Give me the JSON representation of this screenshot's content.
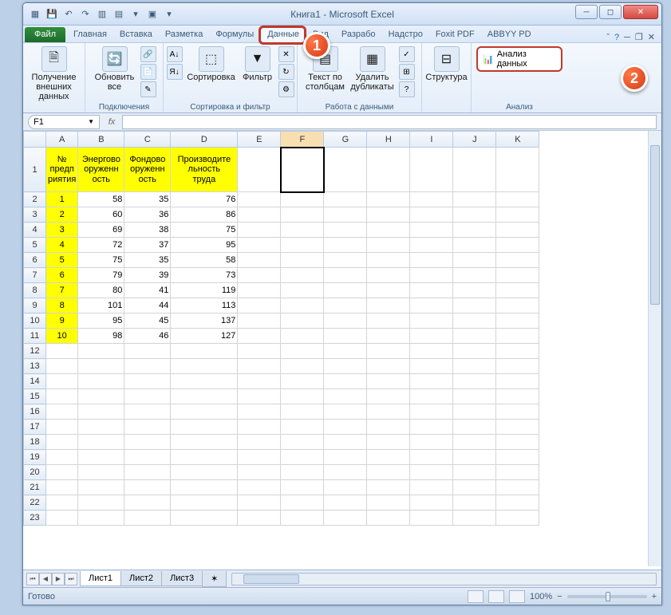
{
  "title": "Книга1 - Microsoft Excel",
  "tabs": {
    "file": "Файл",
    "home": "Главная",
    "insert": "Вставка",
    "layout": "Разметка",
    "formulas": "Формулы",
    "data": "Данные",
    "view": "Вид",
    "dev": "Разрабо",
    "addins": "Надстро",
    "foxit": "Foxit PDF",
    "abbyy": "ABBYY PD"
  },
  "ribbon": {
    "ext_data": "Получение\nвнешних данных",
    "refresh": "Обновить\nвсе",
    "connections": "Подключения",
    "sort": "Сортировка",
    "filter": "Фильтр",
    "sort_filter_group": "Сортировка и фильтр",
    "text_cols": "Текст по\nстолбцам",
    "remove_dup": "Удалить\nдубликаты",
    "data_tools_group": "Работа с данными",
    "structure": "Структура",
    "analysis_btn": "Анализ данных",
    "analysis_group": "Анализ"
  },
  "namebox": "F1",
  "columns": [
    "A",
    "B",
    "C",
    "D",
    "E",
    "F",
    "G",
    "H",
    "I",
    "J",
    "K"
  ],
  "headers": {
    "a": "№\nпредп\nриятия",
    "b": "Энергово\nоруженн\nость",
    "c": "Фондово\nоруженн\nость",
    "d": "Производите\nльность\nтруда"
  },
  "rows": [
    {
      "n": "1",
      "b": "58",
      "c": "35",
      "d": "76"
    },
    {
      "n": "2",
      "b": "60",
      "c": "36",
      "d": "86"
    },
    {
      "n": "3",
      "b": "69",
      "c": "38",
      "d": "75"
    },
    {
      "n": "4",
      "b": "72",
      "c": "37",
      "d": "95"
    },
    {
      "n": "5",
      "b": "75",
      "c": "35",
      "d": "58"
    },
    {
      "n": "6",
      "b": "79",
      "c": "39",
      "d": "73"
    },
    {
      "n": "7",
      "b": "80",
      "c": "41",
      "d": "119"
    },
    {
      "n": "8",
      "b": "101",
      "c": "44",
      "d": "113"
    },
    {
      "n": "9",
      "b": "95",
      "c": "45",
      "d": "137"
    },
    {
      "n": "10",
      "b": "98",
      "c": "46",
      "d": "127"
    }
  ],
  "sheets": {
    "s1": "Лист1",
    "s2": "Лист2",
    "s3": "Лист3"
  },
  "status": "Готово",
  "zoom": "100%"
}
